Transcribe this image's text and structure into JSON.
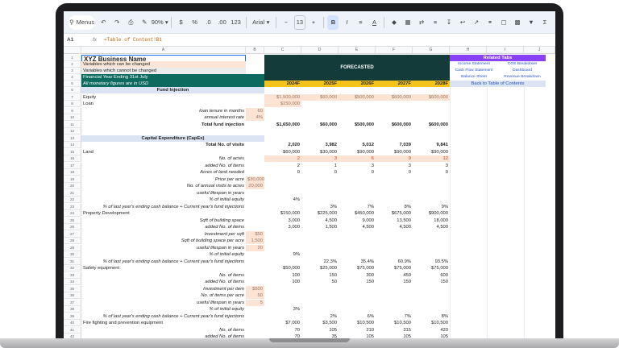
{
  "toolbar": {
    "menus_label": "Menus",
    "zoom": "90%",
    "currency": "$",
    "percent": "%",
    "dec_decrease": ".0",
    "dec_increase": ".00",
    "number_format": "123",
    "font": "Arial",
    "font_size": "13",
    "bold": "B",
    "italic": "I",
    "text_color": "A"
  },
  "formula_bar": {
    "cell_ref": "A1",
    "fx": "fx",
    "formula": "=Table of Content!B1"
  },
  "columns": [
    "A",
    "B",
    "C",
    "D",
    "E",
    "F",
    "G",
    "H",
    "I",
    "J"
  ],
  "forecast_header": "FORECASTED",
  "years": [
    "2024F",
    "2025F",
    "2026F",
    "2027F",
    "2028F"
  ],
  "legend": {
    "title": "XYZ Business Name",
    "variable_changeable": "Variables which can be changed",
    "variable_fixed": "Variables which cannot be changed",
    "fy": "Financial Year Ending 31st July",
    "currency_note": "All monetary figures are in USD"
  },
  "related_tabs": {
    "title": "Related Tabs",
    "links": [
      "Income Statement",
      "COS Breakdown",
      "Cash Flow Statement",
      "Dashboard",
      "Balance Sheet",
      "Revenue Breakdown"
    ],
    "back": "Back to Table of Contents"
  },
  "rows": [
    {
      "n": "6",
      "a": "Fund Injection",
      "cls": "section"
    },
    {
      "n": "7",
      "a": "Equity",
      "c": "$1,500,000",
      "d": "$60,000",
      "e": "$500,000",
      "f": "$600,000",
      "g": "$600,000",
      "vcls": "peach"
    },
    {
      "n": "8",
      "a": "Loan",
      "c": "$150,000",
      "vcls": "peach"
    },
    {
      "n": "9",
      "a": "loan tenure in months",
      "b": "60",
      "acls": "i r",
      "bcls": "peach"
    },
    {
      "n": "10",
      "a": "annual interest rate",
      "b": "4%",
      "acls": "i r",
      "bcls": "peach"
    },
    {
      "n": "11",
      "a": "Total fund injection",
      "c": "$1,650,000",
      "d": "$60,000",
      "e": "$500,000",
      "f": "$600,000",
      "g": "$600,000",
      "acls": "b r",
      "vcls": "total"
    },
    {
      "n": "12",
      "a": ""
    },
    {
      "n": "13",
      "a": "Capital Expenditure (CapEx)",
      "cls": "section"
    },
    {
      "n": "14",
      "a": "Total No. of visits",
      "c": "2,020",
      "d": "3,982",
      "e": "5,012",
      "f": "7,039",
      "g": "9,841",
      "acls": "b r",
      "vcls": "total"
    },
    {
      "n": "15",
      "a": "Land",
      "c": "$60,000",
      "d": "$30,000",
      "e": "$90,000",
      "f": "$90,000",
      "g": "$90,000"
    },
    {
      "n": "16",
      "a": "No. of acres",
      "c": "2",
      "d": "3",
      "e": "6",
      "f": "9",
      "g": "12",
      "acls": "i r",
      "vcls": "peach-red"
    },
    {
      "n": "17",
      "a": "added No. of items",
      "c": "2",
      "d": "1",
      "e": "3",
      "f": "3",
      "g": "3",
      "acls": "i r"
    },
    {
      "n": "18",
      "a": "Acres of land needed",
      "c": "0",
      "d": "0",
      "e": "0",
      "f": "0",
      "g": "0",
      "acls": "i r"
    },
    {
      "n": "19",
      "a": "Price per acre",
      "b": "$30,000",
      "acls": "i r",
      "bcls": "peach"
    },
    {
      "n": "20",
      "a": "No. of annual visits to acres",
      "b": "20,000",
      "acls": "i r",
      "bcls": "peach"
    },
    {
      "n": "21",
      "a": "useful lifespan in years",
      "acls": "i r"
    },
    {
      "n": "22",
      "a": "% of initial equity",
      "c": "4%",
      "acls": "i r"
    },
    {
      "n": "23",
      "a": "% of last year's ending cash balance + Current year's fund injections",
      "d": "3%",
      "e": "7%",
      "f": "8%",
      "g": "9%",
      "acls": "i r"
    },
    {
      "n": "24",
      "a": "Property Development",
      "c": "$150,000",
      "d": "$225,000",
      "e": "$450,000",
      "f": "$675,000",
      "g": "$900,000"
    },
    {
      "n": "25",
      "a": "Sqft of building space",
      "c": "3,000",
      "d": "4,500",
      "e": "9,000",
      "f": "13,500",
      "g": "18,000",
      "acls": "i r"
    },
    {
      "n": "26",
      "a": "added No. of items",
      "c": "3,000",
      "d": "1,500",
      "e": "4,500",
      "f": "4,500",
      "g": "4,500",
      "acls": "i r"
    },
    {
      "n": "27",
      "a": "Investment per sqft",
      "b": "$50",
      "acls": "i r",
      "bcls": "peach"
    },
    {
      "n": "28",
      "a": "Sqft of building space per acre",
      "b": "1,500",
      "acls": "i r",
      "bcls": "peach"
    },
    {
      "n": "29",
      "a": "useful lifespan in years",
      "b": "20",
      "acls": "i r",
      "bcls": "peach"
    },
    {
      "n": "30",
      "a": "% of initial equity",
      "c": "9%",
      "acls": "i r"
    },
    {
      "n": "31",
      "a": "% of last year's ending cash balance + Current year's fund injections",
      "d": "22.3%",
      "e": "35.4%",
      "f": "60.9%",
      "g": "93.5%",
      "acls": "i r"
    },
    {
      "n": "32",
      "a": "Safety equipment",
      "c": "$50,000",
      "d": "$25,000",
      "e": "$75,000",
      "f": "$75,000",
      "g": "$75,000"
    },
    {
      "n": "33",
      "a": "No. of items",
      "c": "100",
      "d": "150",
      "e": "300",
      "f": "450",
      "g": "600",
      "acls": "i r"
    },
    {
      "n": "34",
      "a": "added No. of items",
      "c": "100",
      "d": "50",
      "e": "150",
      "f": "150",
      "g": "150",
      "acls": "i r"
    },
    {
      "n": "35",
      "a": "Investment per item",
      "b": "$500",
      "acls": "i r",
      "bcls": "peach"
    },
    {
      "n": "36",
      "a": "No. of items per acre",
      "b": "50",
      "acls": "i r",
      "bcls": "peach"
    },
    {
      "n": "37",
      "a": "useful lifespan in years",
      "b": "5",
      "acls": "i r",
      "bcls": "peach"
    },
    {
      "n": "38",
      "a": "% of initial equity",
      "c": "3%",
      "acls": "i r"
    },
    {
      "n": "39",
      "a": "% of last year's ending cash balance + Current year's fund injections",
      "d": "2%",
      "e": "6%",
      "f": "7%",
      "g": "8%",
      "acls": "i r"
    },
    {
      "n": "40",
      "a": "Fire fighting and prevention equipment",
      "c": "$7,000",
      "d": "$3,500",
      "e": "$10,500",
      "f": "$10,500",
      "g": "$10,500"
    },
    {
      "n": "41",
      "a": "No. of items",
      "c": "70",
      "d": "105",
      "e": "210",
      "f": "315",
      "g": "420",
      "acls": "i r"
    },
    {
      "n": "42",
      "a": "added No. of items",
      "c": "70",
      "d": "35",
      "e": "105",
      "f": "105",
      "g": "105",
      "acls": "i r"
    },
    {
      "n": "43",
      "a": "Investment per item",
      "b": "$100",
      "acls": "i r",
      "bcls": "peach"
    },
    {
      "n": "44",
      "a": "No. of items per acre",
      "b": "35",
      "acls": "i r",
      "bcls": "peach"
    }
  ]
}
